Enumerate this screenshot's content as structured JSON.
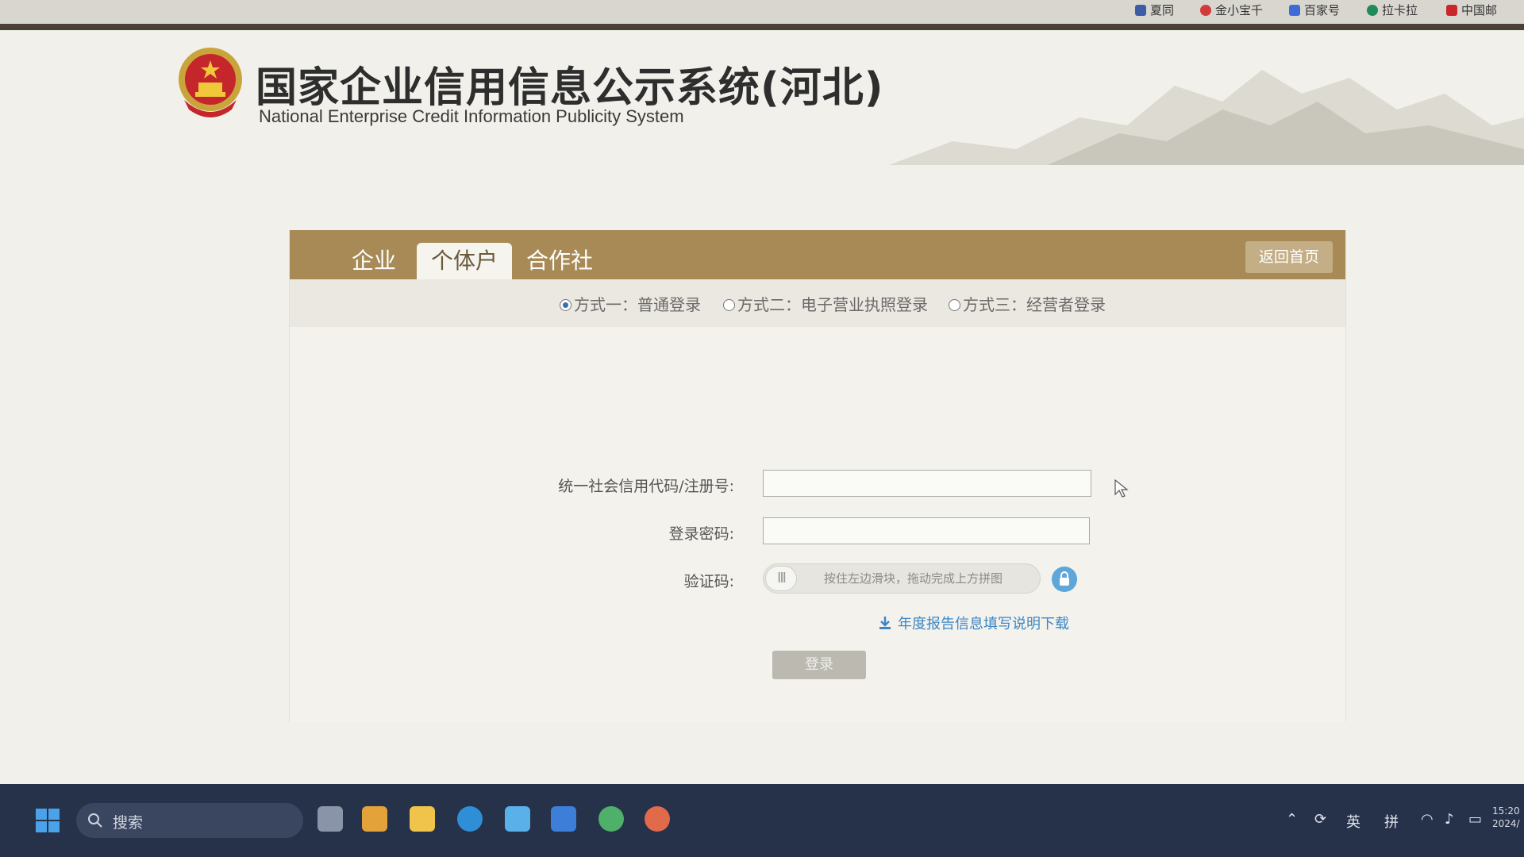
{
  "bookmarks": [
    {
      "label": "夏同",
      "color": "#3d5ca8"
    },
    {
      "label": "金小宝千",
      "color": "#d23a3a"
    },
    {
      "label": "百家号",
      "color": "#3f6ad8"
    },
    {
      "label": "拉卡拉",
      "color": "#1f8a5a"
    },
    {
      "label": "中国邮",
      "color": "#c8282d"
    }
  ],
  "header": {
    "emblem_icon": "national-emblem-icon",
    "title_cn": "国家企业信用信息公示系统(河北)",
    "title_en": "National Enterprise Credit Information Publicity System"
  },
  "tabs": [
    {
      "label": "企业",
      "active": false
    },
    {
      "label": "个体户",
      "active": true
    },
    {
      "label": "合作社",
      "active": false
    }
  ],
  "back_home_label": "返回首页",
  "login_methods": [
    {
      "label": "方式一：普通登录",
      "checked": true
    },
    {
      "label": "方式二：电子营业执照登录",
      "checked": false
    },
    {
      "label": "方式三：经营者登录",
      "checked": false
    }
  ],
  "form": {
    "credit_code_label": "统一社会信用代码/注册号:",
    "credit_code_value": "",
    "password_label": "登录密码:",
    "password_value": "",
    "captcha_label": "验证码:",
    "slider_hint": "按住左边滑块，拖动完成上方拼图",
    "slider_handle": "III",
    "download_link": "年度报告信息填写说明下载",
    "login_button": "登录"
  },
  "taskbar": {
    "search_placeholder": "搜索",
    "tray_lang": "英",
    "tray_ime": "拼",
    "clock_time": "15:20",
    "clock_date": "2024/"
  },
  "colors": {
    "tabbar": "#a78a56",
    "link": "#3d86c6",
    "taskbar": "#26314a"
  }
}
